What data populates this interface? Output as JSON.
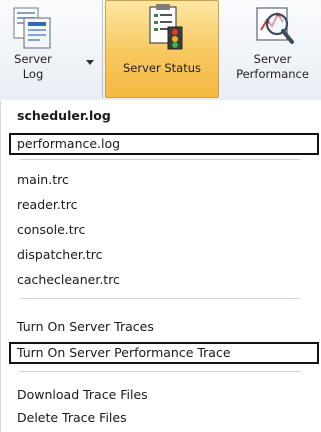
{
  "ribbon": {
    "server_log": {
      "line1": "Server",
      "line2": "Log"
    },
    "server_status": {
      "label": "Server Status"
    },
    "server_performance": {
      "line1": "Server",
      "line2": "Performance"
    }
  },
  "menu": {
    "items": [
      {
        "label": "scheduler.log",
        "bold": true,
        "outlined": false
      },
      {
        "label": "performance.log",
        "outlined": true
      },
      {
        "label": "main.trc"
      },
      {
        "label": "reader.trc"
      },
      {
        "label": "console.trc"
      },
      {
        "label": "dispatcher.trc"
      },
      {
        "label": "cachecleaner.trc"
      },
      {
        "label": "Turn On Server Traces"
      },
      {
        "label": "Turn On Server Performance Trace",
        "outlined": true
      },
      {
        "label": "Download Trace Files"
      },
      {
        "label": "Delete Trace Files"
      }
    ]
  },
  "colors": {
    "active_gradient_top": "#fde7a4",
    "active_gradient_bottom": "#f5b842",
    "outline": "#111111"
  },
  "icons": {
    "server_log": "document-log-icon",
    "server_status": "server-status-icon",
    "server_performance": "performance-chart-icon",
    "dropdown": "dropdown-arrow-icon"
  }
}
